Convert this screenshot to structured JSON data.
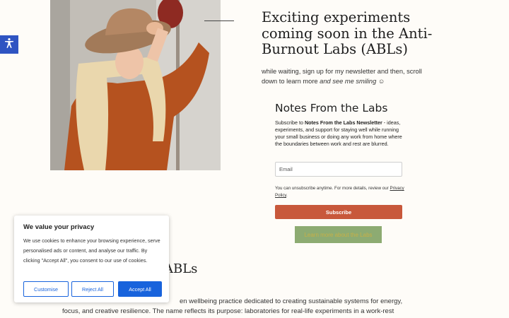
{
  "colors": {
    "accent_blue": "#1863dc",
    "a11y_blue": "#2f54c2",
    "subscribe_orange": "#c8583b",
    "learn_green": "#8dab72",
    "background": "#fefcf8"
  },
  "accessibility": {
    "icon": "accessibility-icon"
  },
  "hero": {
    "title": "Exciting experiments coming soon in the Anti-Burnout Labs (ABLs)",
    "subtitle_plain": "while waiting, sign up for my newsletter and then, scroll down to learn more ",
    "subtitle_italic": "and see me smiling",
    "subtitle_emoji": "☺"
  },
  "newsletter": {
    "title": "Notes From the Labs",
    "desc_prefix": "Subscribe to ",
    "desc_bold": "Notes From the Labs Newsletter",
    "desc_suffix": " - ideas, experiments, and support for staying well while running your small business or doing any work from home where the boundaries between work and rest are blurred.",
    "email_placeholder": "Email",
    "note_text": "You can unsubscribe anytime. For more details, review our ",
    "privacy_link": "Privacy Policy",
    "note_end": ".",
    "subscribe_label": "Subscribe",
    "learn_more_label": "Learn more about the Labs"
  },
  "section": {
    "heading_tail": "ABLs",
    "body_line1_tail": "en wellbeing practice dedicated to creating sustainable systems for energy,",
    "body_line2": "focus, and creative resilience. The name reflects its purpose: laboratories for real-life experiments in a work-rest"
  },
  "cookie": {
    "title": "We value your privacy",
    "text": "We use cookies to enhance your browsing experience, serve personalised ads or content, and analyse our traffic. By clicking \"Accept All\", you consent to our use of cookies.",
    "customise": "Customise",
    "reject": "Reject All",
    "accept": "Accept All"
  }
}
